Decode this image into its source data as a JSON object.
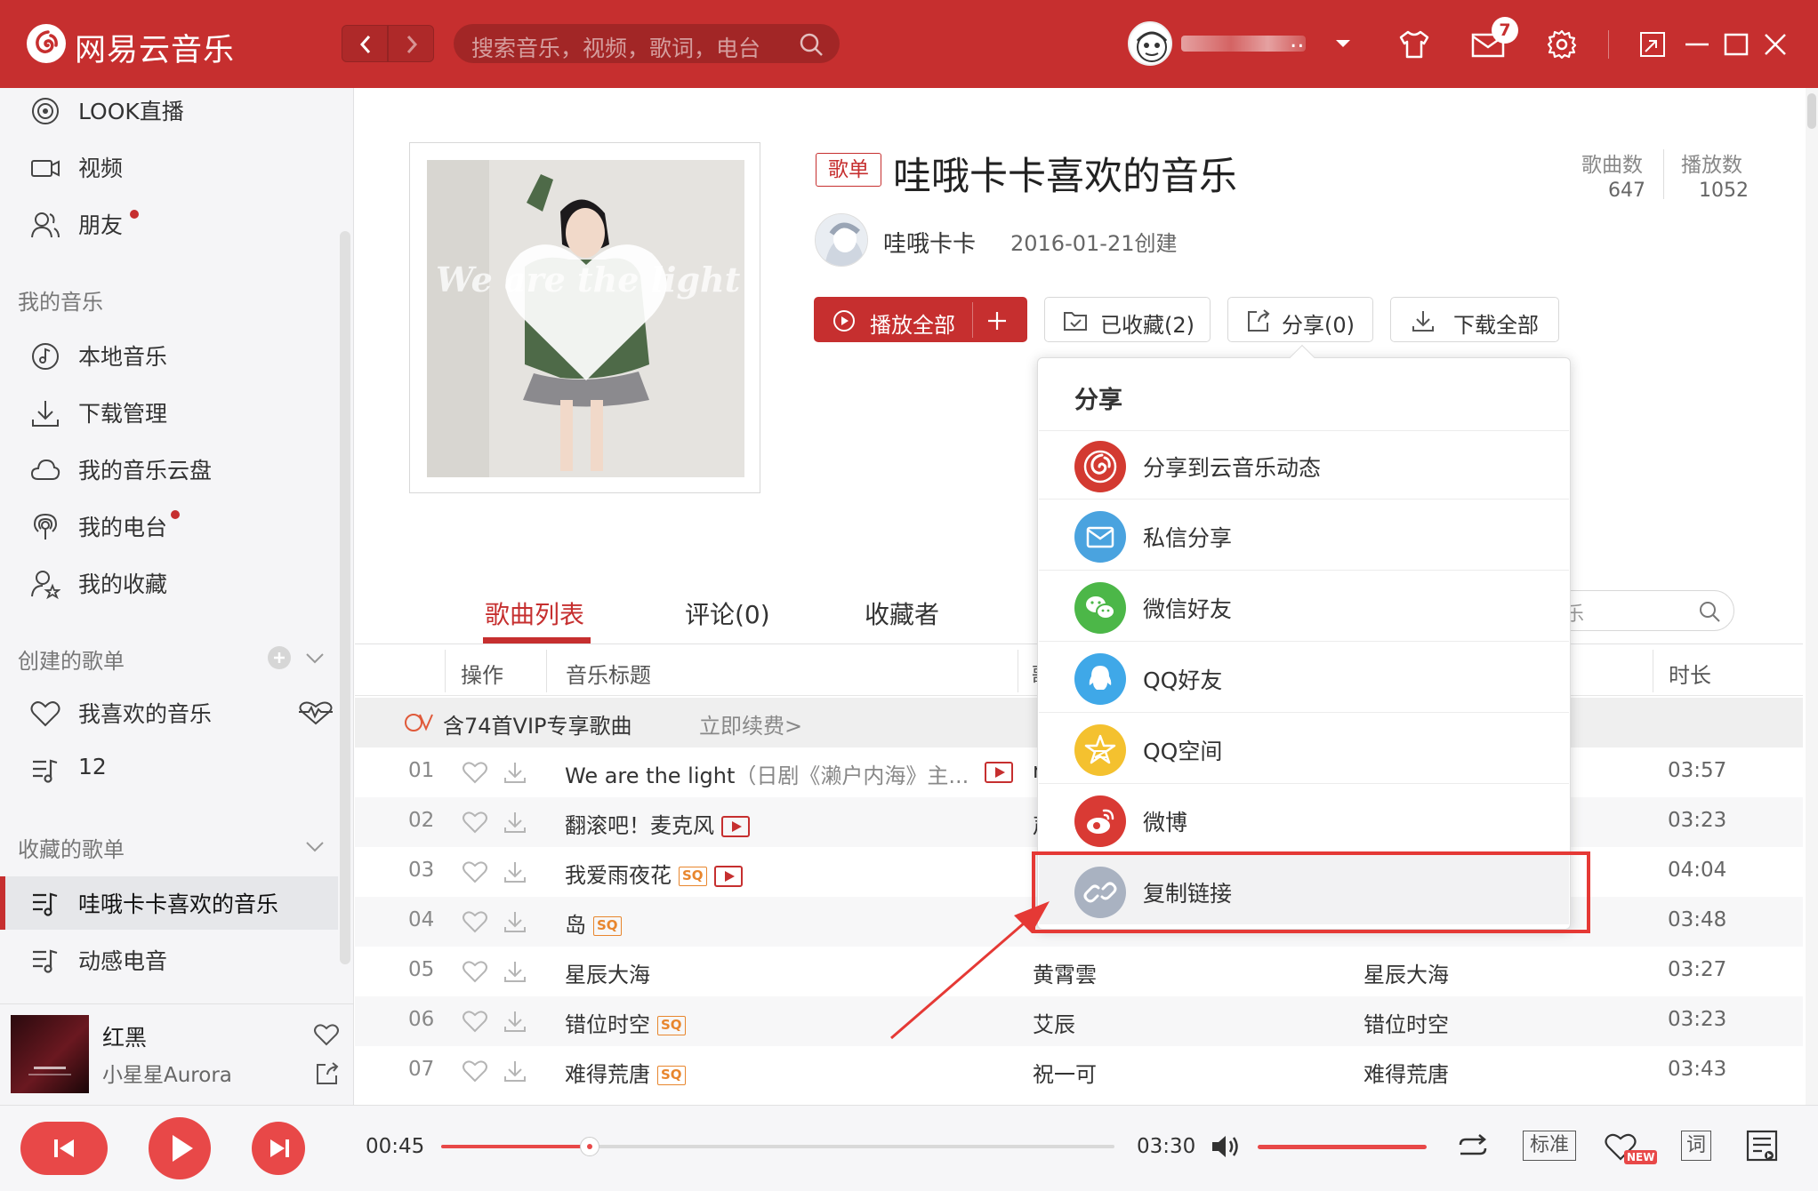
{
  "header": {
    "app_title": "网易云音乐",
    "search_placeholder": "搜索音乐，视频，歌词，电台",
    "user_suffix": "..",
    "message_count": "7"
  },
  "sidebar": {
    "top_items": [
      {
        "label": "LOOK直播",
        "icon": "live-icon"
      },
      {
        "label": "视频",
        "icon": "video-icon"
      },
      {
        "label": "朋友",
        "icon": "friends-icon"
      }
    ],
    "my_music_title": "我的音乐",
    "my_music_items": [
      {
        "label": "本地音乐",
        "icon": "local-music-icon"
      },
      {
        "label": "下载管理",
        "icon": "download-icon"
      },
      {
        "label": "我的音乐云盘",
        "icon": "cloud-icon"
      },
      {
        "label": "我的电台",
        "icon": "radio-icon"
      },
      {
        "label": "我的收藏",
        "icon": "collection-icon"
      }
    ],
    "created_title": "创建的歌单",
    "created_items": [
      {
        "label": "我喜欢的音乐",
        "icon": "heart-icon"
      },
      {
        "label": "12",
        "icon": "playlist-icon"
      }
    ],
    "collected_title": "收藏的歌单",
    "collected_items": [
      {
        "label": "哇哦卡卡喜欢的音乐",
        "icon": "playlist-icon"
      },
      {
        "label": "动感电音",
        "icon": "playlist-icon"
      }
    ]
  },
  "now_playing": {
    "title": "红黑",
    "artist": "小星星Aurora",
    "current_time": "00:45",
    "total_time": "03:30",
    "progress": 0.22,
    "quality": "标准",
    "lyric": "词",
    "new_badge": "NEW"
  },
  "playlist": {
    "tag": "歌单",
    "title": "哇哦卡卡喜欢的音乐",
    "creator": "哇哦卡卡",
    "created": "2016-01-21创建",
    "songs_label": "歌曲数",
    "songs_count": "647",
    "plays_label": "播放数",
    "plays_count": "1052",
    "cover_text": "We are the light",
    "buttons": {
      "play_all": "播放全部",
      "collected": "已收藏(2)",
      "share": "分享(0)",
      "download_all": "下载全部"
    },
    "tabs": [
      "歌曲列表",
      "评论(0)",
      "收藏者"
    ],
    "search_fragment": "乐"
  },
  "table": {
    "headers": {
      "op": "操作",
      "title": "音乐标题",
      "artist_fragment": "歌",
      "duration": "时长"
    },
    "vip_notice": "含74首VIP专享歌曲",
    "vip_renew": "立即续费>",
    "rows": [
      {
        "num": "01",
        "title": "We are the light",
        "sub": "（日剧《濑户内海》主...",
        "badge": "mv",
        "artist": "r",
        "album": "",
        "duration": "03:57"
      },
      {
        "num": "02",
        "title": "翻滚吧！麦克风",
        "sub": "",
        "badge": "mv",
        "artist": "声",
        "album": "",
        "duration": "03:23"
      },
      {
        "num": "03",
        "title": "我爱雨夜花",
        "sub": "",
        "badge": "sq+mv",
        "artist": "",
        "album": "",
        "duration": "04:04"
      },
      {
        "num": "04",
        "title": "岛",
        "sub": "",
        "badge": "sq",
        "artist": "",
        "album": "",
        "duration": "03:48"
      },
      {
        "num": "05",
        "title": "星辰大海",
        "sub": "",
        "badge": "",
        "artist": "黄霄雲",
        "album": "星辰大海",
        "duration": "03:27"
      },
      {
        "num": "06",
        "title": "错位时空",
        "sub": "",
        "badge": "sq",
        "artist": "艾辰",
        "album": "错位时空",
        "duration": "03:23"
      },
      {
        "num": "07",
        "title": "难得荒唐",
        "sub": "",
        "badge": "sq",
        "artist": "祝一可",
        "album": "难得荒唐",
        "duration": "03:43"
      }
    ]
  },
  "share_popup": {
    "title": "分享",
    "items": [
      {
        "label": "分享到云音乐动态",
        "icon": "netease-icon",
        "color": "#d33a31"
      },
      {
        "label": "私信分享",
        "icon": "mail-icon",
        "color": "#4aa3df"
      },
      {
        "label": "微信好友",
        "icon": "wechat-icon",
        "color": "#4cb748"
      },
      {
        "label": "QQ好友",
        "icon": "qq-icon",
        "color": "#3fa8e8"
      },
      {
        "label": "QQ空间",
        "icon": "qzone-icon",
        "color": "#f4c12f"
      },
      {
        "label": "微博",
        "icon": "weibo-icon",
        "color": "#d93a34"
      },
      {
        "label": "复制链接",
        "icon": "link-icon",
        "color": "#a9b2c1"
      }
    ]
  },
  "colors": {
    "brand": "#c62f2f",
    "highlight": "#e53935"
  }
}
